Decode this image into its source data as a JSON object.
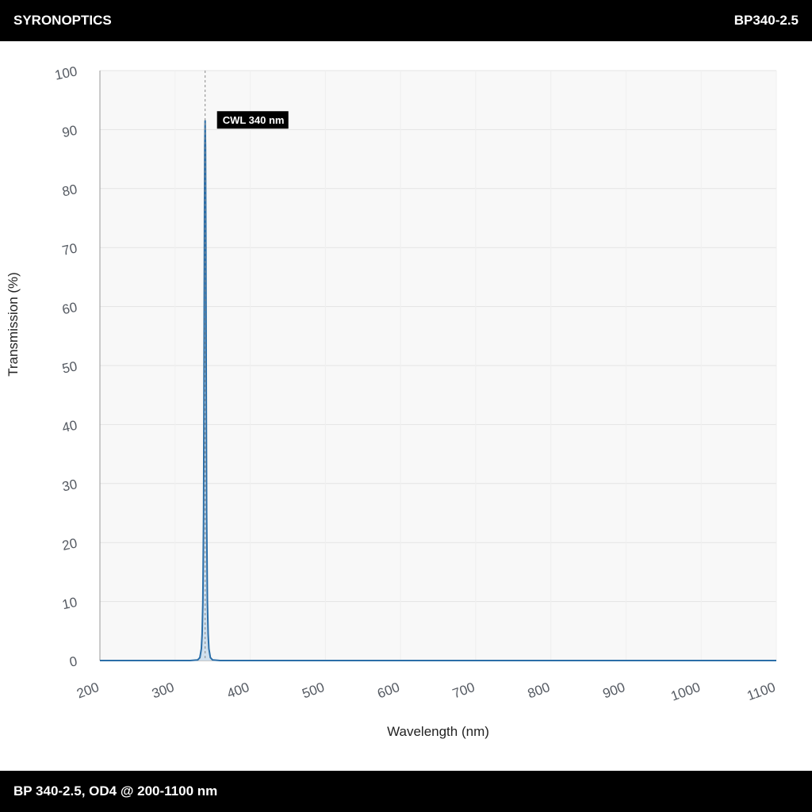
{
  "header": {
    "brand": "SYRONOPTICS",
    "product_code": "BP340-2.5"
  },
  "footer": {
    "caption": "BP 340-2.5, OD4 @ 200-1100 nm"
  },
  "colors": {
    "line": "#2b6ea8",
    "fill": "#c9dcec",
    "plot_background": "#f8f8f8",
    "grid": "#e4e4e4",
    "annotation_background": "#000000"
  },
  "chart_data": {
    "type": "area",
    "xlabel": "Wavelength (nm)",
    "ylabel": "Transmission (%)",
    "xlim": [
      200,
      1100
    ],
    "ylim": [
      0,
      100
    ],
    "x_ticks": [
      "200",
      "300",
      "400",
      "500",
      "600",
      "700",
      "800",
      "900",
      "1000",
      "1100"
    ],
    "y_ticks": [
      "0",
      "10",
      "20",
      "30",
      "40",
      "50",
      "60",
      "70",
      "80",
      "90",
      "100"
    ],
    "grid": true,
    "series": [
      {
        "x": [
          200,
          320,
          330,
          333,
          335,
          336,
          337,
          338,
          338.5,
          339,
          339.5,
          340,
          340.5,
          341,
          341.5,
          342,
          343,
          344,
          345,
          347,
          350,
          360,
          1100
        ],
        "y": [
          0,
          0,
          0.1,
          0.5,
          2,
          4.5,
          10,
          25,
          45,
          70,
          87,
          91.5,
          87,
          70,
          45,
          25,
          10,
          4.5,
          2,
          0.5,
          0.1,
          0,
          0
        ]
      }
    ],
    "annotations": [
      {
        "x": 340,
        "y": 91.5,
        "text": "CWL 340 nm"
      }
    ]
  }
}
